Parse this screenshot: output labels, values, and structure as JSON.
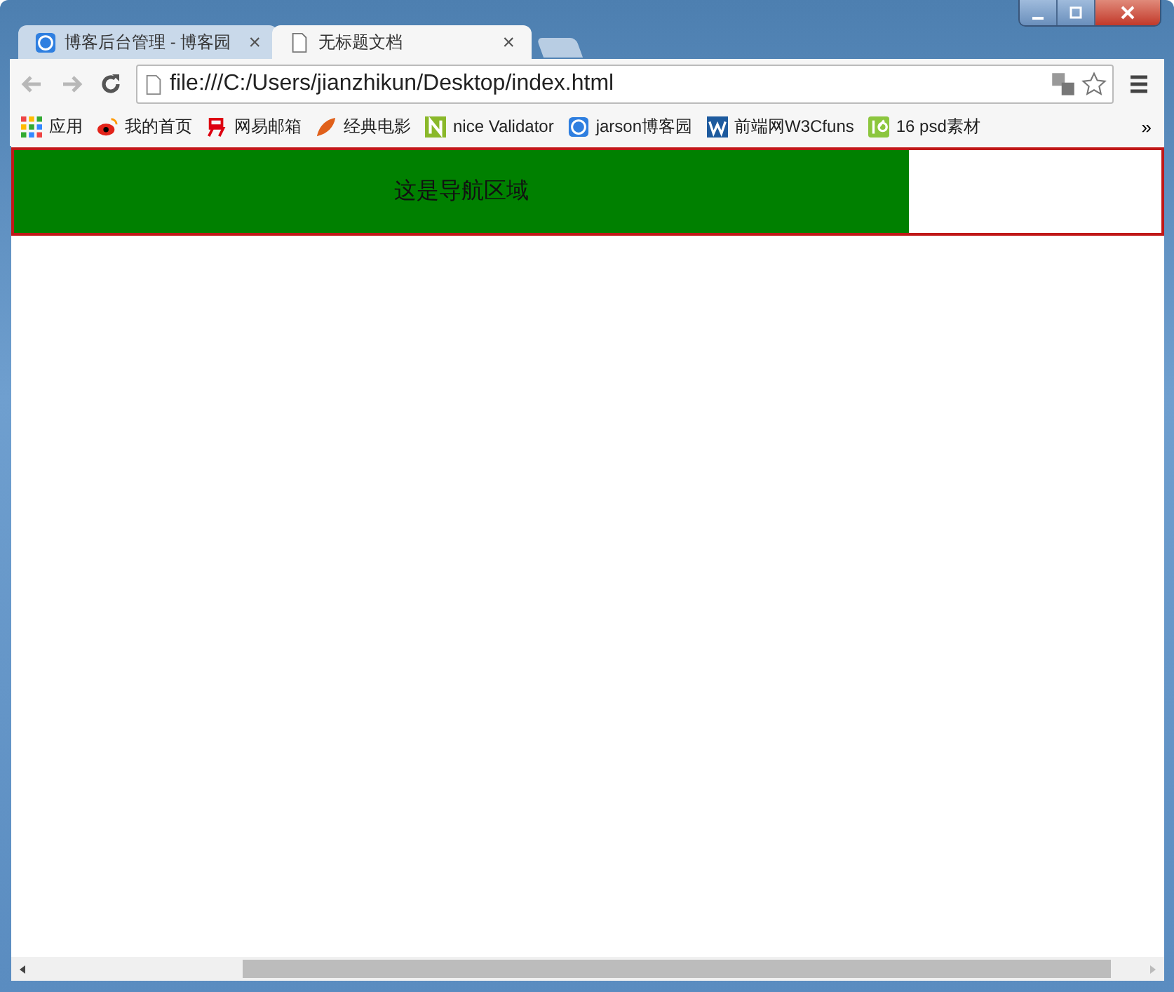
{
  "tabs": [
    {
      "title": "博客后台管理 - 博客园",
      "selected": false,
      "close": "×"
    },
    {
      "title": "无标题文档",
      "selected": true,
      "close": "×"
    }
  ],
  "address": {
    "value": "file:///C:/Users/jianzhikun/Desktop/index.html"
  },
  "bookmarks": [
    {
      "label": "应用"
    },
    {
      "label": "我的首页"
    },
    {
      "label": "网易邮箱"
    },
    {
      "label": "经典电影"
    },
    {
      "label": "nice Validator"
    },
    {
      "label": "jarson博客园"
    },
    {
      "label": "前端网W3Cfuns"
    },
    {
      "label": "16 psd素材"
    }
  ],
  "bookmarks_more": "»",
  "page": {
    "nav_text": "这是导航区域"
  }
}
